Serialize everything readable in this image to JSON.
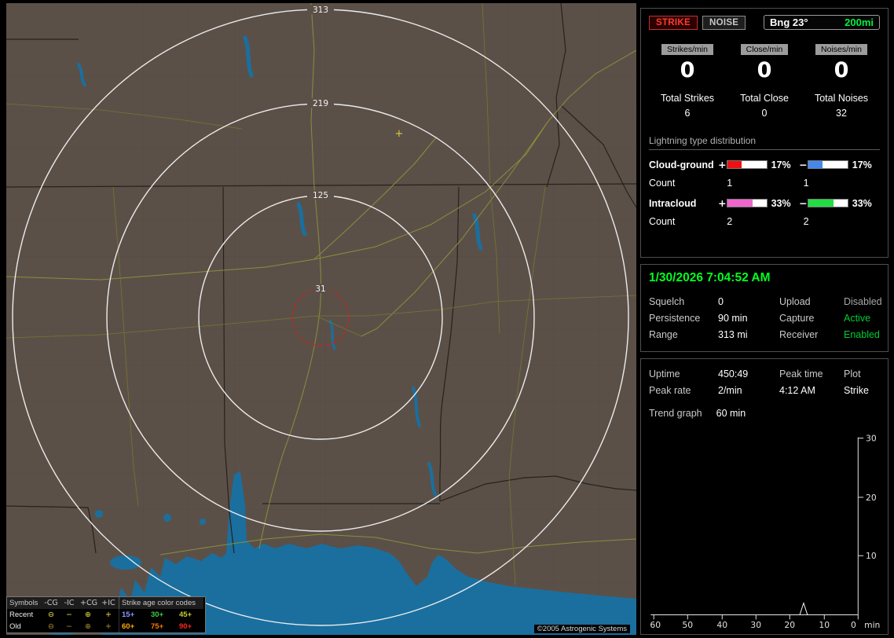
{
  "map": {
    "range_labels": {
      "r313": "313",
      "r219": "219",
      "r125": "125",
      "r31": "31"
    },
    "center_marker": "+",
    "copyright": "©2005 Astrogenic Systems",
    "legend": {
      "symbols_header": "Symbols",
      "cols": [
        "-CG",
        "-IC",
        "+CG",
        "+IC"
      ],
      "age_header": "Strike age color codes",
      "rows": [
        {
          "label": "Recent",
          "s1": "⊖",
          "s2": "−",
          "s3": "⊕",
          "s4": "+",
          "sym_color": "#f0e040",
          "ages": [
            {
              "t": "15+",
              "c": "#8899ff"
            },
            {
              "t": "30+",
              "c": "#44cc44"
            },
            {
              "t": "45+",
              "c": "#cccc33"
            }
          ]
        },
        {
          "label": "Old",
          "s1": "⊖",
          "s2": "−",
          "s3": "⊕",
          "s4": "+",
          "sym_color": "#b09028",
          "ages": [
            {
              "t": "60+",
              "c": "#ffaa00"
            },
            {
              "t": "75+",
              "c": "#ff7700"
            },
            {
              "t": "90+",
              "c": "#ff2222"
            }
          ]
        }
      ]
    }
  },
  "panel": {
    "strike_button": "STRIKE",
    "noise_button": "NOISE",
    "bearing_label": "Bng 23°",
    "range_label": "200mi",
    "range_color": "#00ee44",
    "rates": [
      {
        "label": "Strikes/min",
        "value": "0"
      },
      {
        "label": "Close/min",
        "value": "0"
      },
      {
        "label": "Noises/min",
        "value": "0"
      }
    ],
    "totals": [
      {
        "label": "Total Strikes",
        "value": "6"
      },
      {
        "label": "Total Close",
        "value": "0"
      },
      {
        "label": "Total Noises",
        "value": "32"
      }
    ],
    "distribution": {
      "title": "Lightning type distribution",
      "rows": [
        {
          "label": "Cloud-ground",
          "pos_sign": "+",
          "pos_pct": "17%",
          "pos_fill": "36%",
          "pos_color": "#ee1111",
          "neg_sign": "−",
          "neg_pct": "17%",
          "neg_fill": "36%",
          "neg_color": "#4488ee",
          "count_label": "Count",
          "pos_count": "1",
          "neg_count": "1"
        },
        {
          "label": "Intracloud",
          "pos_sign": "+",
          "pos_pct": "33%",
          "pos_fill": "64%",
          "pos_color": "#ee66cc",
          "neg_sign": "−",
          "neg_pct": "33%",
          "neg_fill": "64%",
          "neg_color": "#22dd44",
          "count_label": "Count",
          "pos_count": "2",
          "neg_count": "2"
        }
      ]
    },
    "datetime": "1/30/2026 7:04:52 AM",
    "settings": {
      "rows": [
        {
          "l1": "Squelch",
          "v1": "0",
          "l2": "Upload",
          "v2": "Disabled",
          "v2_color": "#a8a8a8"
        },
        {
          "l1": "Persistence",
          "v1": "90 min",
          "l2": "Capture",
          "v2": "Active",
          "v2_color": "#00cc33"
        },
        {
          "l1": "Range",
          "v1": "313 mi",
          "l2": "Receiver",
          "v2": "Enabled",
          "v2_color": "#00cc33"
        }
      ]
    },
    "stats": {
      "uptime_label": "Uptime",
      "uptime_value": "450:49",
      "peaktime_label": "Peak time",
      "peaktime_value": "4:12 AM",
      "plot_label": "Plot",
      "plot_value": "Strike",
      "peakrate_label": "Peak rate",
      "peakrate_value": "2/min",
      "trend_label": "Trend graph",
      "trend_value": "60 min"
    }
  },
  "chart_data": {
    "type": "line",
    "title": "Trend graph (60 min)",
    "x_unit": "min",
    "x_ticks": [
      "60",
      "50",
      "40",
      "30",
      "20",
      "10",
      "0"
    ],
    "y_ticks": [
      "30",
      "20",
      "10"
    ],
    "ylim": [
      0,
      30
    ],
    "xlim_minutes_ago": [
      60,
      0
    ],
    "points": [
      {
        "x": 16,
        "y": 2
      }
    ]
  }
}
